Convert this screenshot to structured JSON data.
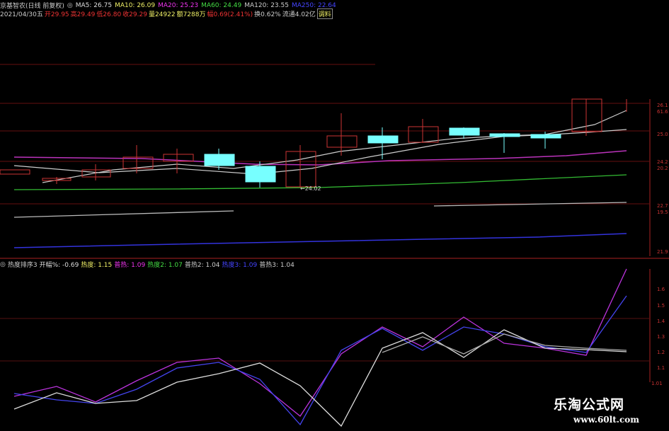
{
  "title_row": {
    "stock": "京基智农(日线 前复权)",
    "ma5_label": "MA5: 26.75",
    "ma10_label": "MA10: 26.09",
    "ma20_label": "MA20: 25.23",
    "ma60_label": "MA60: 24.49",
    "ma120_label": "MA120: 23.55",
    "ma250_label": "MA250: 22.64"
  },
  "quote_row": {
    "date": "2021/04/30五",
    "open": "开29.95",
    "high": "高29.49",
    "low": "低26.80",
    "close": "收29.29",
    "volume": "量24922",
    "amount": "额7288万",
    "change": "幅0.69(2.41%)",
    "turnover": "换0.62%",
    "float": "流通4.02亿",
    "extra": "调料"
  },
  "price_pane": {
    "low_marker": "←24.02",
    "axis_labels": [
      "26.1",
      "61.6",
      "25.0",
      "24.2",
      "20.2",
      "22.7",
      "19.5",
      "21.9"
    ]
  },
  "indicator_row": {
    "name": "热度排序3",
    "open_label": "开幅%: -0.69",
    "heat_label": "热度: 1.15",
    "sheat_label": "普热: 1.09",
    "heat2_label": "热度2: 1.07",
    "sheat2_label": "普热2: 1.04",
    "heat3_label": "热度3: 1.09",
    "sheat3_label": "普热3: 1.04"
  },
  "indicator_pane": {
    "axis_labels": [
      "1.6",
      "1.5",
      "1.4",
      "1.3",
      "1.2",
      "1.1",
      "1.01"
    ]
  },
  "watermark": {
    "title": "乐淘公式网",
    "url": "www.60lt.com"
  },
  "colors": {
    "up": "#d22",
    "down": "#7ff",
    "ma5": "#ccc",
    "ma10": "#ccc",
    "ma20": "#c3c",
    "ma60": "#3c3",
    "ma120": "#ccc",
    "ma250": "#33f"
  }
}
